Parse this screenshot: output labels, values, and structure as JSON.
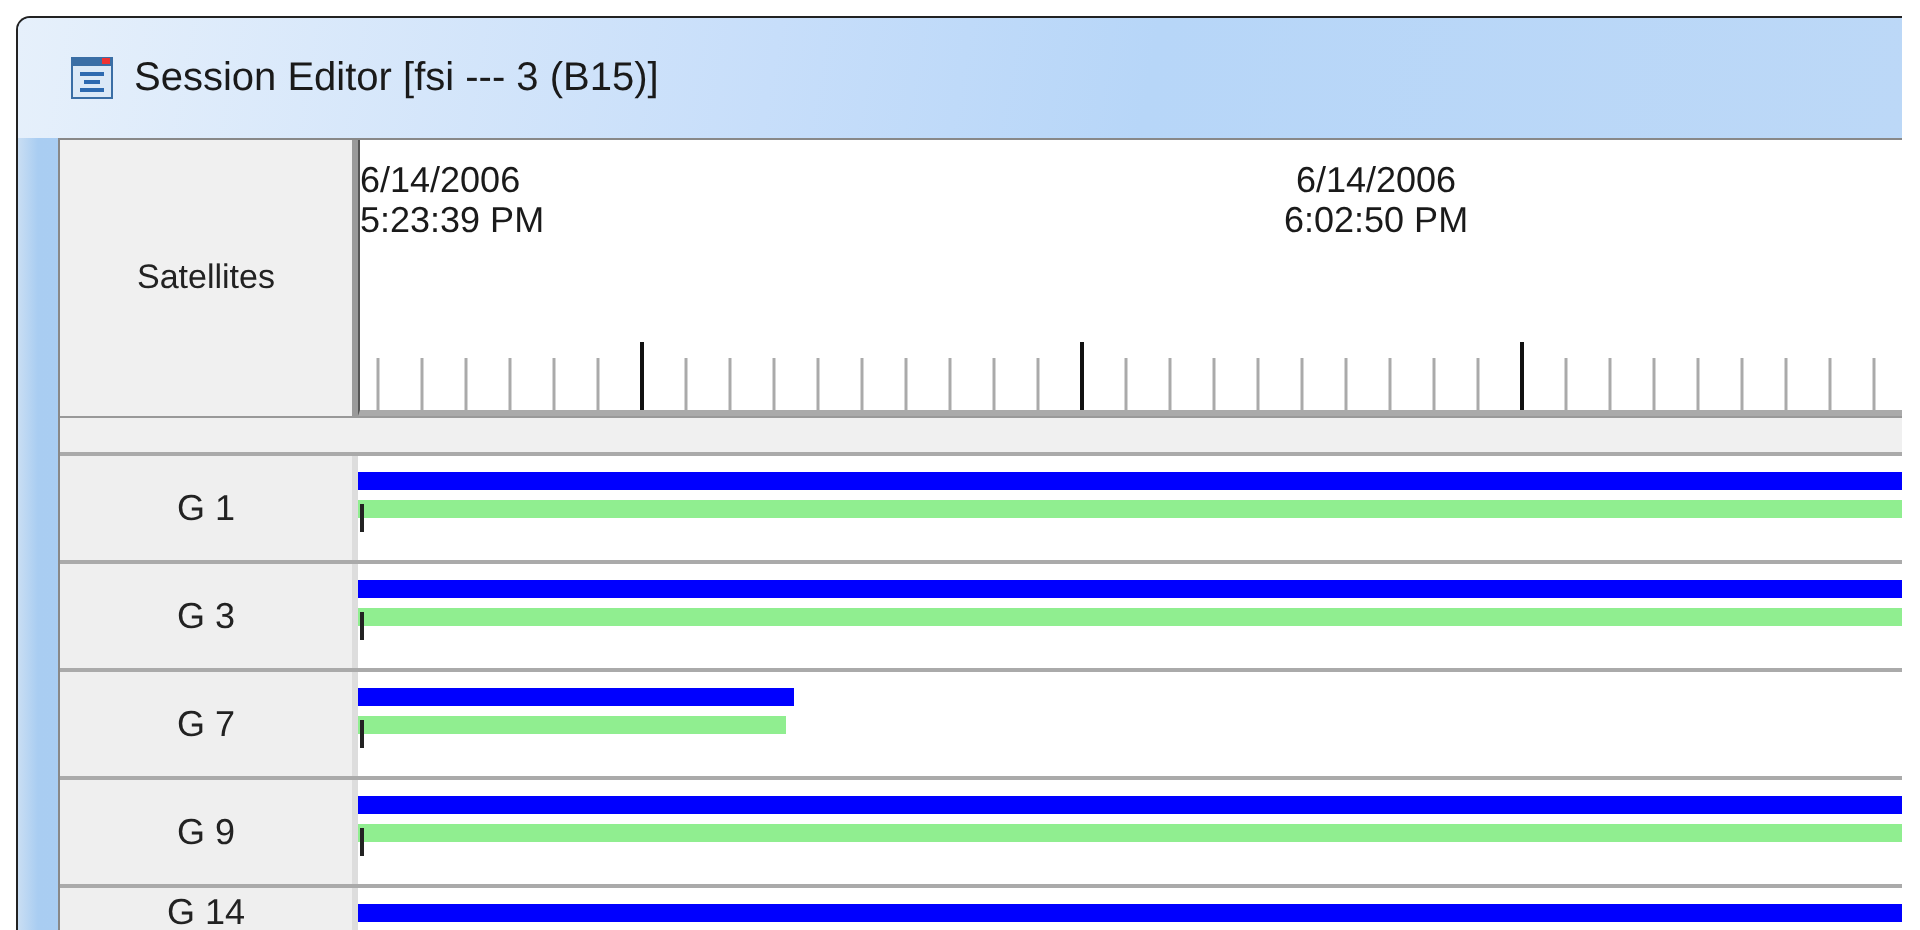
{
  "window": {
    "title": "Session Editor [fsi --- 3 (B15)]"
  },
  "header": {
    "label": "Satellites",
    "time_labels": [
      {
        "date": "6/14/2006",
        "time": "5:23:39 PM",
        "kind": "edge"
      },
      {
        "date": "6/14/2006",
        "time": "6:02:50 PM",
        "kind": "centered"
      }
    ]
  },
  "rows": [
    {
      "label": "G 1",
      "bars": [
        {
          "kind": "primary",
          "level": 1
        },
        {
          "kind": "secondary",
          "level": 1
        }
      ]
    },
    {
      "label": "G 3",
      "bars": [
        {
          "kind": "primary",
          "level": 1
        },
        {
          "kind": "secondary",
          "level": 1
        }
      ]
    },
    {
      "label": "G 7",
      "bars": [
        {
          "kind": "primary",
          "level": 0.282
        },
        {
          "kind": "secondary",
          "level": 0.277
        }
      ]
    },
    {
      "label": "G 9",
      "bars": [
        {
          "kind": "primary",
          "level": 1
        },
        {
          "kind": "secondary",
          "level": 1
        }
      ]
    },
    {
      "label": "G 14",
      "bars": [
        {
          "kind": "primary",
          "level": 1
        }
      ]
    }
  ]
}
